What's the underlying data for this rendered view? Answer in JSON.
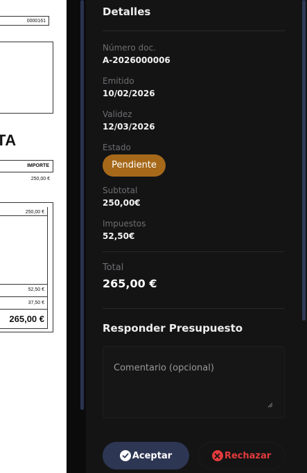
{
  "document_preview": {
    "doc_number_fragment": "0000161",
    "heading_fragment": "TA",
    "column_header": "IMPORTE",
    "line_amount": "250,00 €",
    "table_amount_1": "250,00 €",
    "table_amount_2": "52,50 €",
    "table_amount_3": "37,50 €",
    "table_total": "265,00 €"
  },
  "details": {
    "title": "Detalles",
    "doc_number_label": "Número doc.",
    "doc_number_value": "A-2026000006",
    "issued_label": "Emitido",
    "issued_value": "10/02/2026",
    "validity_label": "Validez",
    "validity_value": "12/03/2026",
    "status_label": "Estado",
    "status_value": "Pendiente",
    "subtotal_label": "Subtotal",
    "subtotal_value": "250,00€",
    "taxes_label": "Impuestos",
    "taxes_value": "52,50€",
    "total_label": "Total",
    "total_value": "265,00 €"
  },
  "response": {
    "title": "Responder Presupuesto",
    "comment_placeholder": "Comentario (opcional)",
    "accept_label": "Aceptar",
    "reject_label": "Rechazar"
  },
  "colors": {
    "status_badge": "#a6691a",
    "accept_button": "#2d3652",
    "reject_text": "#e23b3b"
  },
  "icons": {
    "accept": "check-circle-icon",
    "reject": "x-circle-icon",
    "textarea_resize": "resize-grip-icon"
  }
}
